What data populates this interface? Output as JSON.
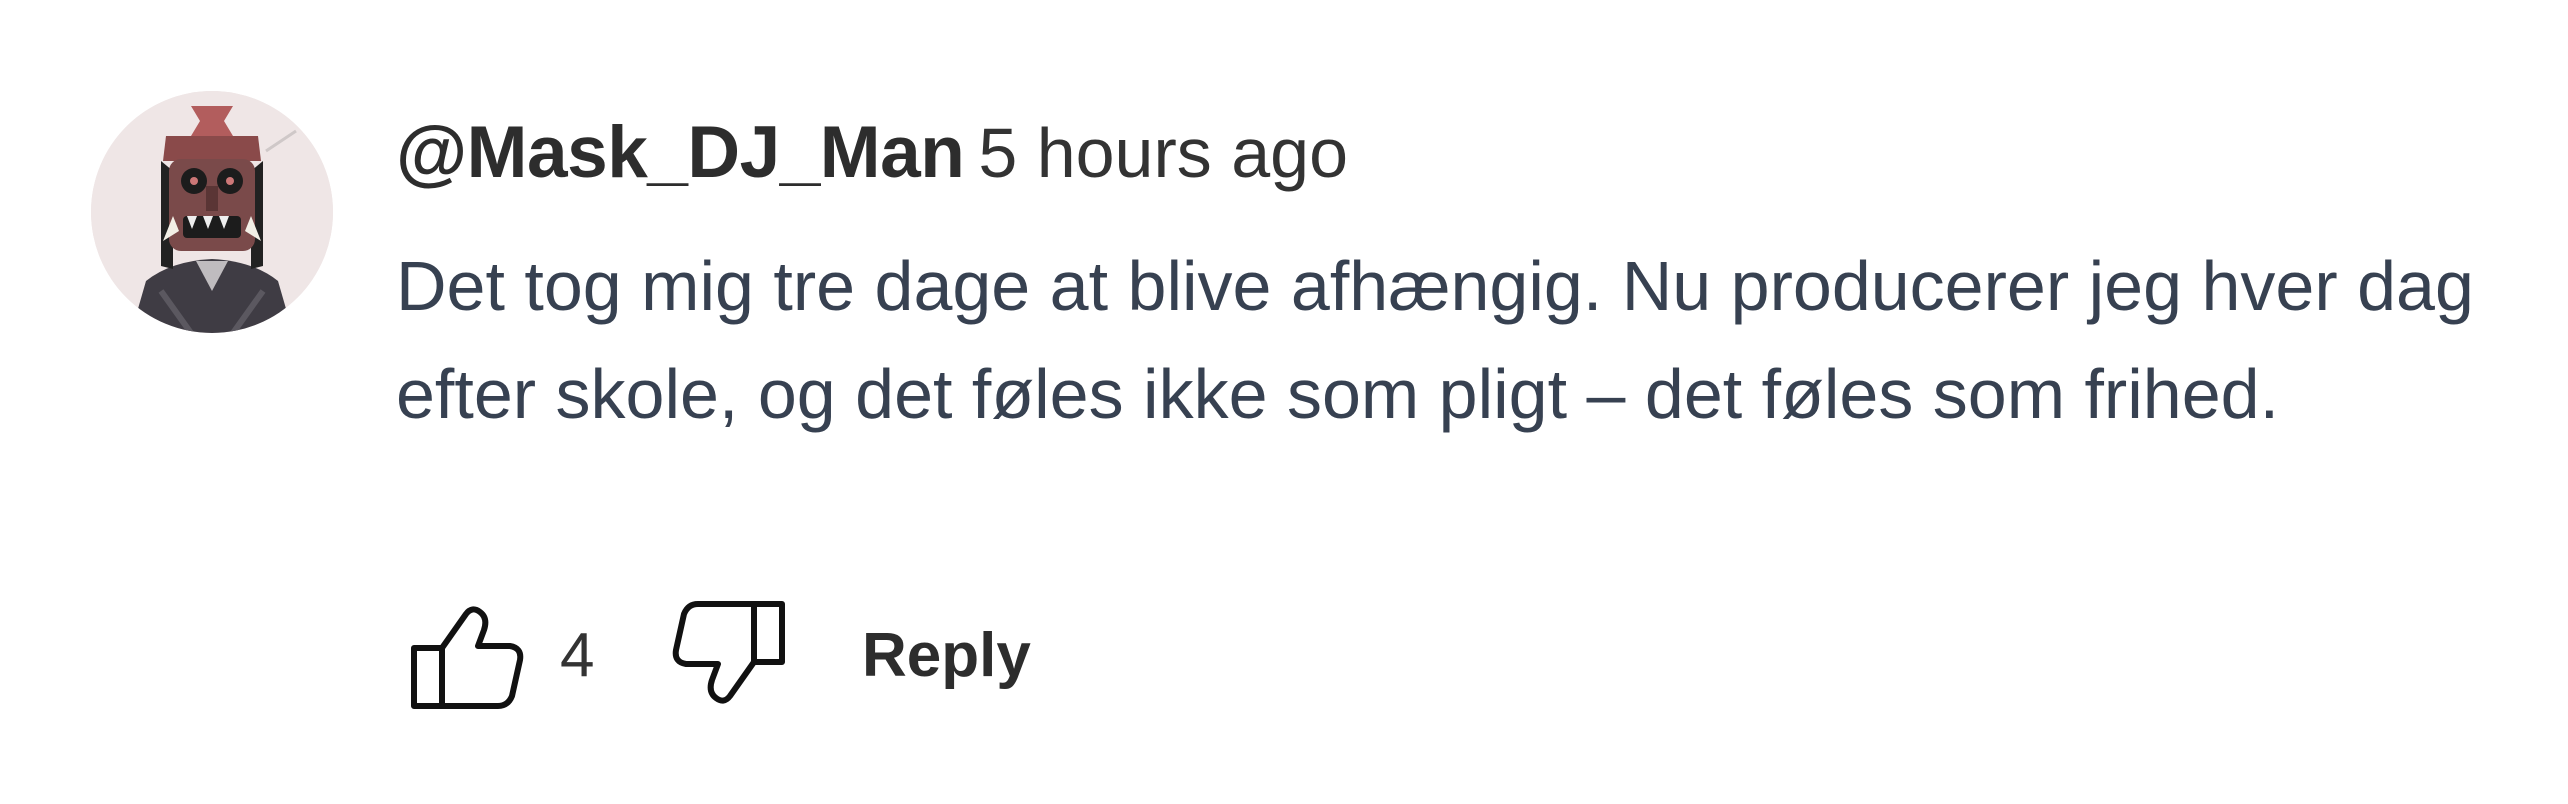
{
  "comment": {
    "author": "@Mask_DJ_Man",
    "timestamp": "5 hours ago",
    "text": "Det tog mig tre dage at blive afhængig. Nu producerer jeg hver dag efter skole, og det føles ikke som pligt – det føles som frihed.",
    "avatar_icon": "masked-character-avatar"
  },
  "actions": {
    "like_icon": "thumbs-up-icon",
    "like_count": "4",
    "dislike_icon": "thumbs-down-icon",
    "reply_label": "Reply"
  },
  "colors": {
    "username": "#2d2d2d",
    "body_text": "#374151",
    "background": "#ffffff"
  }
}
